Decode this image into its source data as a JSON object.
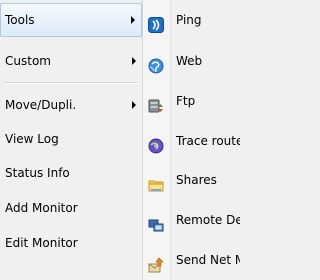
{
  "main_menu": {
    "items": [
      {
        "label": "Tools",
        "has_submenu": true,
        "selected": true
      },
      {
        "label": "Custom",
        "has_submenu": true
      },
      {
        "label": "Move/Dupli.",
        "has_submenu": true
      },
      {
        "label": "View Log"
      },
      {
        "label": "Status Info"
      },
      {
        "label": "Add Monitor"
      },
      {
        "label": "Edit Monitor"
      }
    ]
  },
  "submenu": {
    "items": [
      {
        "label": "Ping",
        "icon": "ping-icon"
      },
      {
        "label": "Web",
        "icon": "web-icon"
      },
      {
        "label": "Ftp",
        "icon": "ftp-icon"
      },
      {
        "label": "Trace route",
        "icon": "trace-route-icon"
      },
      {
        "label": "Shares",
        "icon": "shares-icon"
      },
      {
        "label": "Remote Desktop",
        "icon": "remote-desktop-icon"
      },
      {
        "label": "Send Net Message",
        "icon": "send-net-message-icon"
      }
    ]
  },
  "colors": {
    "menu_bg": "#f0f0f0",
    "highlight_border": "#a9c8ea",
    "highlight_fill": "#ddebf9"
  }
}
